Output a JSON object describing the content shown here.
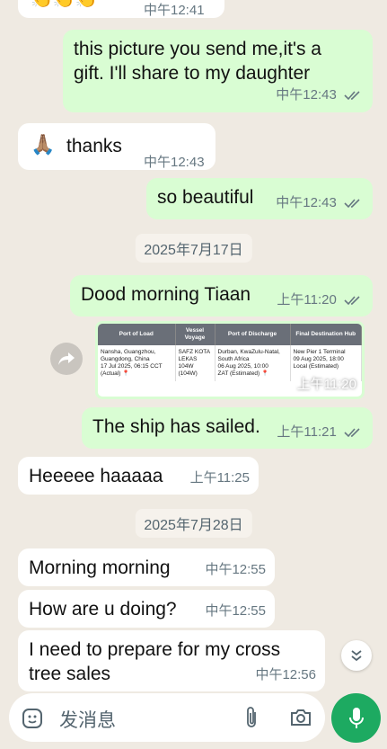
{
  "messages": {
    "m0_time": "中午12:41",
    "m1_text": "this picture you send me,it's a gift. I'll share to my daughter",
    "m1_time": "中午12:43",
    "m2_emoji": "🙏🏽",
    "m2_text": "thanks",
    "m2_time": "中午12:43",
    "m3_text": "so beautiful",
    "m3_time": "中午12:43",
    "date1": "2025年7月17日",
    "m4_text": "Dood morning Tiaan",
    "m4_time": "上午11:20",
    "m5_time": "上午11:20",
    "m6_text": "The ship has sailed.",
    "m6_time": "上午11:21",
    "m7_text": "Heeeee haaaaa",
    "m7_time": "上午11:25",
    "date2": "2025年7月28日",
    "m8_text": "Morning morning",
    "m8_time": "中午12:55",
    "m9_text": "How are u doing?",
    "m9_time": "中午12:55",
    "m10_text": "I need to prepare for my cross tree sales",
    "m10_time": "中午12:56"
  },
  "shipping_image": {
    "headers": [
      "Port of Load",
      "Vessel Voyage",
      "Port of Discharge",
      "Final Destination Hub"
    ],
    "load": "Nansha, Guangzhou, Guangdong, China",
    "load_date": "17 Jul 2025, 06:15 CCT",
    "load_status": "(Actual)",
    "vessel": "SAFZ KOTA LEKAS",
    "voyage1": "104W",
    "voyage2": "(104W)",
    "discharge": "Durban, KwaZulu-Natal, South Africa",
    "discharge_date": "06 Aug 2025, 10:00",
    "discharge_status": "ZAT (Estimated)",
    "final": "New Pier 1 Terminal",
    "final_date": "09 Aug 2025, 18:00",
    "final_status": "Local (Estimated)"
  },
  "input": {
    "placeholder": "发消息"
  },
  "colors": {
    "outgoing": "#d9fdd3",
    "incoming": "#ffffff",
    "accent": "#1daa61",
    "tick": "#53bdeb"
  },
  "icons": [
    "sticker-icon",
    "attach-icon",
    "camera-icon",
    "mic-icon",
    "forward-icon",
    "chevron-down-icon",
    "double-check-icon"
  ]
}
